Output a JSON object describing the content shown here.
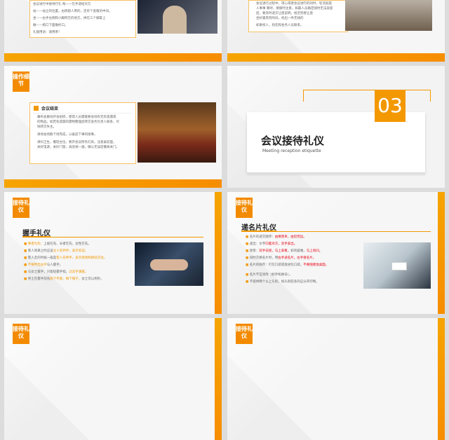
{
  "slides": {
    "s1": {
      "lines": [
        "会议进行中接待行礼 每一一在手递给对方",
        "站——站立的位置，右侧留人用的，还有个宽敞的中间。",
        "坐——右手左侧和小脚所在的地方，拱在三个脚掌上",
        "做——梳口下面确杆口。",
        "礼貌用语：请用茶！"
      ]
    },
    "s2": {
      "lines": [
        "会议进行过程中，得心或者会议进行的同时，轮流就座",
        "人事事 尊呼，要随时注意，如最人员确定随时无法就座",
        "后，要及时递交让座说明，给迟到者让座",
        "坐好嘉宾到时间，找出一件无线的",
        "如果找人，别先和会务人员联系。"
      ]
    },
    "s3": {
      "badge": "操作细节",
      "heading": "会议结束",
      "lines": [
        "幕布会散场开会组织，使得人员需联要会场有无有遗漏或",
        "的物品。如若有遗漏的需物整理后转交会务负责人联系，尽",
        "快转交失主。",
        "清场会场散下场完成，以备迎下事的接事。",
        "清扫卫生，撤轻台位，要开会议所有灯具，注意桌前面，",
        "关好电源，关好门窗，再巡视一遍，确认无误后撤离关门。"
      ]
    },
    "s4": {
      "number": "03",
      "title": "会议接待礼仪",
      "subtitle": "Meeting reception etiquette"
    },
    "s5": {
      "badge": "接待礼仪",
      "title": "握手礼仪",
      "lines": [
        {
          "a": "尊者为先：",
          "b": "上级在先、长者在先、女性在先。"
        },
        {
          "a": "",
          "b": "客人到来之时应该",
          "c": "主人先伸手，表示欢迎。"
        },
        {
          "a": "",
          "b": "客人走的时候一般是",
          "c": "客人先伸手，表示感谢和继续交往。"
        },
        {
          "a": "不要伸出左手",
          "b": "与人握手。"
        },
        {
          "a": "",
          "b": "与女士握手，只能轻握手指，",
          "c": "忌双手满握。"
        },
        {
          "a": "",
          "b": "男士在握手前先",
          "c": "脱下手套、摘下帽子，",
          "d": "女士可以例外。"
        }
      ]
    },
    "s6": {
      "badge": "接待礼仪",
      "title": "递名片礼仪",
      "lines": [
        {
          "a": "名片的递交顺序：",
          "c": "由尊而卑，由近而远。"
        },
        {
          "a": "递出：文字",
          "c": "向着对方，双手拿出。"
        },
        {
          "a": "接受：",
          "c": "双手去接，马上拿看，",
          "b": "如有疑难，",
          "d": "马上询问。"
        },
        {
          "a": "同时交换名片时，用",
          "c": "右手递名片，左手接名片。"
        },
        {
          "a": "名片的收存：钉在口袋或放进包口袋。",
          "c": "不要随便放桌面。"
        },
        {
          "a": "名片不宜涂改（如手机换号）。"
        },
        {
          "a": "不提供两个以上头衔，如头衔较多的应分开印制。"
        }
      ]
    },
    "s7": {
      "badge": "接待礼仪"
    },
    "s8": {
      "badge": "接待礼仪"
    }
  }
}
